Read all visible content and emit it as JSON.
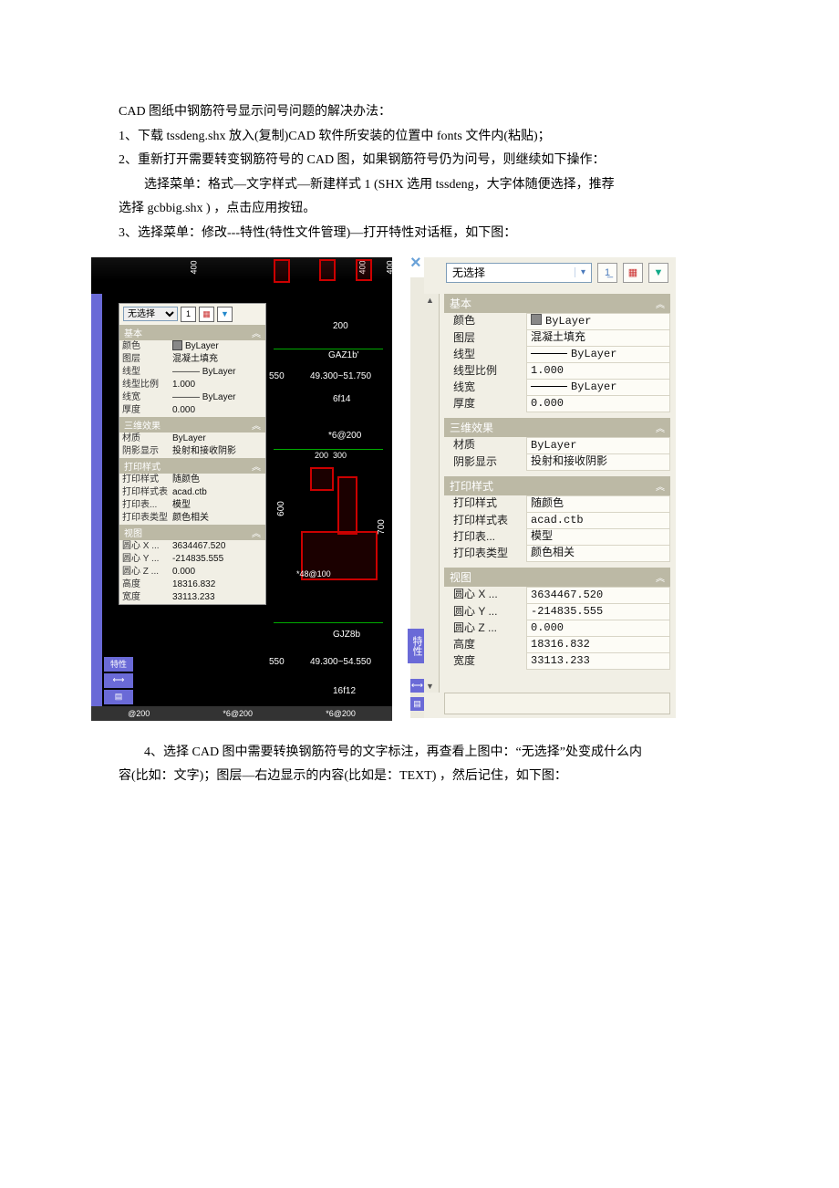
{
  "text": {
    "p1": "CAD 图纸中钢筋符号显示问号问题的解决办法：",
    "p2": "1、下载 tssdeng.shx 放入(复制)CAD 软件所安装的位置中 fonts 文件内(粘贴)；",
    "p3": "2、重新打开需要转变钢筋符号的 CAD 图，如果钢筋符号仍为问号，则继续如下操作：",
    "p4": "选择菜单：格式—文字样式—新建样式 1   (SHX 选用 tssdeng，大字体随便选择，推荐",
    "p5": "选择 gcbbig.shx )  ，点击应用按钮。",
    "p6": "3、选择菜单：修改---特性(特性文件管理)—打开特性对话框，如下图：",
    "p7": "4、选择 CAD 图中需要转换钢筋符号的文字标注，再查看上图中：“无选择”处变成什么内",
    "p8": "容(比如：文字)；图层—右边显示的内容(比如是：TEXT)  ，然后记住，如下图："
  },
  "left": {
    "dims": {
      "d400a": "400",
      "d400b": "400",
      "d400c": "400",
      "d200": "200",
      "d600": "600",
      "d700": "700",
      "d200b": "200",
      "d300": "300"
    },
    "labels": {
      "gaz": "GAZ1b'",
      "range1": "49.300~51.750",
      "t6f14": "6f14",
      "t46200": "*6@200",
      "t48100": "*48@100",
      "gjz": "GJZ8b",
      "range2": "49.300~54.550",
      "t16f12": "16f12",
      "b1": "@200",
      "b2": "*6@200",
      "b3": "*6@200",
      "r550a": "550",
      "r550b": "550"
    },
    "panel": {
      "sel": "无选择",
      "s_basic": "基本",
      "basic": [
        {
          "k": "颜色",
          "v": "ByLayer",
          "sw": true
        },
        {
          "k": "图层",
          "v": "混凝土填充"
        },
        {
          "k": "线型",
          "v": "——— ByLayer"
        },
        {
          "k": "线型比例",
          "v": "1.000"
        },
        {
          "k": "线宽",
          "v": "——— ByLayer"
        },
        {
          "k": "厚度",
          "v": "0.000"
        }
      ],
      "s_3d": "三维效果",
      "threed": [
        {
          "k": "材质",
          "v": "ByLayer"
        },
        {
          "k": "阴影显示",
          "v": "投射和接收阴影"
        }
      ],
      "s_print": "打印样式",
      "print": [
        {
          "k": "打印样式",
          "v": "随颜色"
        },
        {
          "k": "打印样式表",
          "v": "acad.ctb"
        },
        {
          "k": "打印表...",
          "v": "模型"
        },
        {
          "k": "打印表类型",
          "v": "颜色相关"
        }
      ],
      "s_view": "视图",
      "view": [
        {
          "k": "圆心 X ...",
          "v": "3634467.520"
        },
        {
          "k": "圆心 Y ...",
          "v": "-214835.555"
        },
        {
          "k": "圆心 Z ...",
          "v": "0.000"
        },
        {
          "k": "高度",
          "v": "18316.832"
        },
        {
          "k": "宽度",
          "v": "33113.233"
        }
      ],
      "tab": "特性"
    }
  },
  "right": {
    "sel": "无选择",
    "s_basic": "基本",
    "basic": [
      {
        "k": "颜色",
        "v": "ByLayer",
        "sw": true
      },
      {
        "k": "图层",
        "v": "混凝土填充"
      },
      {
        "k": "线型",
        "v": "ByLayer",
        "line": true
      },
      {
        "k": "线型比例",
        "v": "1.000"
      },
      {
        "k": "线宽",
        "v": "ByLayer",
        "line": true
      },
      {
        "k": "厚度",
        "v": "0.000"
      }
    ],
    "s_3d": "三维效果",
    "threed": [
      {
        "k": "材质",
        "v": "ByLayer"
      },
      {
        "k": "阴影显示",
        "v": "投射和接收阴影"
      }
    ],
    "s_print": "打印样式",
    "print": [
      {
        "k": "打印样式",
        "v": "随颜色"
      },
      {
        "k": "打印样式表",
        "v": "acad.ctb"
      },
      {
        "k": "打印表...",
        "v": "模型"
      },
      {
        "k": "打印表类型",
        "v": "颜色相关"
      }
    ],
    "s_view": "视图",
    "view": [
      {
        "k": "圆心 X ...",
        "v": "3634467.520"
      },
      {
        "k": "圆心 Y ...",
        "v": "-214835.555"
      },
      {
        "k": "圆心 Z ...",
        "v": "0.000"
      },
      {
        "k": "高度",
        "v": "18316.832"
      },
      {
        "k": "宽度",
        "v": "33113.233"
      }
    ],
    "tab": "特性"
  }
}
